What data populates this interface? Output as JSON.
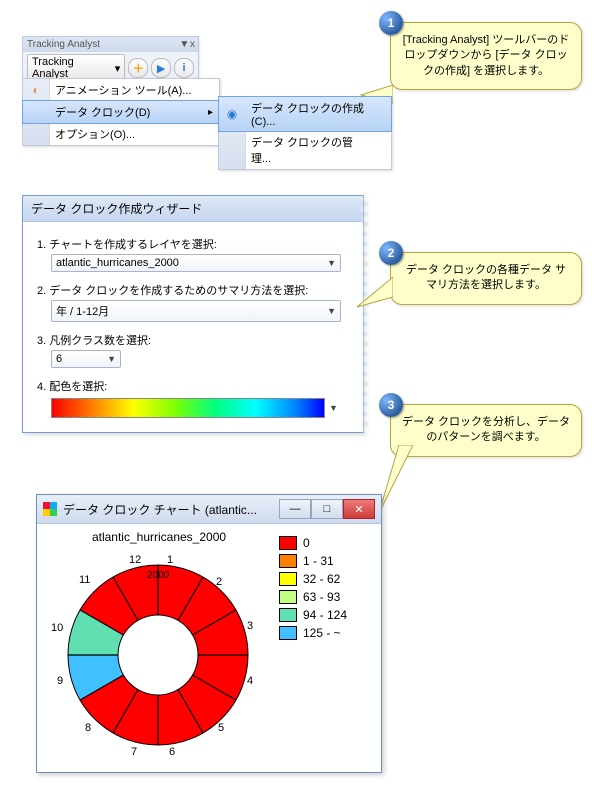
{
  "callouts": {
    "c1": "[Tracking Analyst] ツールバーのドロップダウンから [データ クロックの作成] を選択します。",
    "c2": "データ クロックの各種データ サマリ方法を選択します。",
    "c3": "データ クロックを分析し、データのパターンを調べます。",
    "n1": "1",
    "n2": "2",
    "n3": "3"
  },
  "toolbar": {
    "title": "Tracking Analyst",
    "winclose": "▼ x",
    "dropdown_label": "Tracking Analyst",
    "menu_animation": "アニメーション ツール(A)...",
    "menu_dataclock": "データ クロック(D)",
    "menu_options": "オプション(O)...",
    "submenu_create": "データ クロックの作成(C)...",
    "submenu_manage": "データ クロックの管理..."
  },
  "wizard": {
    "title": "データ クロック作成ウィザード",
    "step1": "1. チャートを作成するレイヤを選択:",
    "layer_value": "atlantic_hurricanes_2000",
    "step2": "2. データ クロックを作成するためのサマリ方法を選択:",
    "summary_value": "年 / 1-12月",
    "step3": "3. 凡例クラス数を選択:",
    "class_value": "6",
    "step4": "4. 配色を選択:"
  },
  "chart_window": {
    "title": "データ クロック チャート (atlantic...",
    "chart_title": "atlantic_hurricanes_2000",
    "ring_year": "2000"
  },
  "legend_labels": {
    "l0": "0",
    "l1": "1 - 31",
    "l2": "32 - 62",
    "l3": "63 - 93",
    "l4": "94 - 124",
    "l5": "125 - ~"
  },
  "legend_colors": {
    "c0": "#ff0000",
    "c1": "#ff7f00",
    "c2": "#ffff00",
    "c3": "#c0ff80",
    "c4": "#60e0b0",
    "c5": "#40c0ff"
  },
  "seg_numbers": {
    "s1": "1",
    "s2": "2",
    "s3": "3",
    "s4": "4",
    "s5": "5",
    "s6": "6",
    "s7": "7",
    "s8": "8",
    "s9": "9",
    "s10": "10",
    "s11": "11",
    "s12": "12"
  },
  "chart_data": {
    "type": "pie",
    "title": "atlantic_hurricanes_2000",
    "categories": [
      "1",
      "2",
      "3",
      "4",
      "5",
      "6",
      "7",
      "8",
      "9",
      "10",
      "11",
      "12"
    ],
    "ring_label": "2000",
    "class_breaks": [
      "0",
      "1 - 31",
      "32 - 62",
      "63 - 93",
      "94 - 124",
      "125 - ~"
    ],
    "class_colors": [
      "#ff0000",
      "#ff7f00",
      "#ffff00",
      "#c0ff80",
      "#60e0b0",
      "#40c0ff"
    ],
    "values_by_month_classindex": [
      0,
      0,
      0,
      0,
      0,
      0,
      0,
      0,
      5,
      4,
      0,
      0
    ],
    "note": "Donut-style data clock; index into class_breaks per month wedge"
  }
}
